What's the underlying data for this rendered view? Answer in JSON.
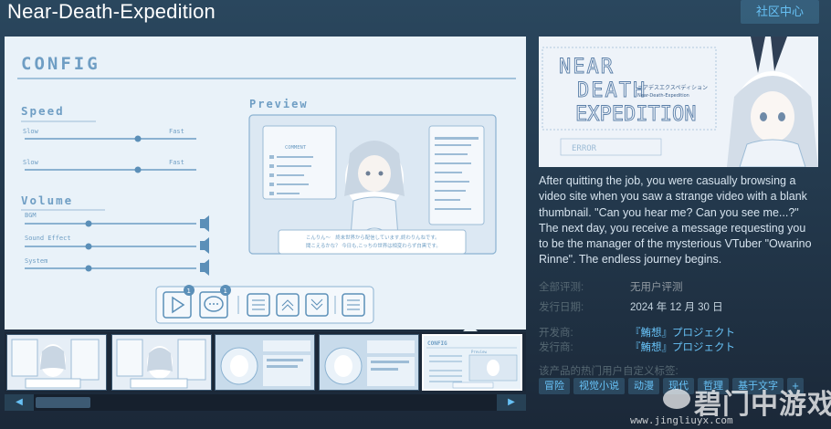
{
  "header": {
    "title": "Near-Death-Expedition",
    "community_button": "社区中心"
  },
  "screenshot": {
    "config_title": "CONFIG",
    "speed_label": "Speed",
    "slow_1": "Slow",
    "fast_1": "Fast",
    "slow_2": "Slow",
    "fast_2": "Fast",
    "volume_label": "Volume",
    "bgm_label": "BGM",
    "sound_effect_label": "Sound Effect",
    "system_label": "System",
    "preview_label": "Preview",
    "comment_label": "COMMENT",
    "dialog_line1": "こんりん〜　終末世界から配信しています,終わりんねです。",
    "dialog_line2": "聞こえるかな？ 今日も,こっちの世界は相変わらず白黒です。",
    "badge_1": "1",
    "badge_2": "1"
  },
  "capsule": {
    "title_line1": "NEAR",
    "title_line2": "DEATH",
    "title_line3": "EXPEDITION",
    "subtitle_jp": "ニアデスエクスペディション",
    "subtitle_en": "Near-Death-Expedition",
    "error_text": "ERROR"
  },
  "description": "After quitting the job, you were casually browsing a video site when you saw a strange video with a blank thumbnail. \"Can you hear me? Can you see me...?\" The next day, you receive a message requesting you to be the manager of the mysterious VTuber \"Owarino Rinne\". The endless journey begins.",
  "info": {
    "reviews_label": "全部评测:",
    "reviews_value": "无用户评测",
    "release_label": "发行日期:",
    "release_value": "2024 年 12 月 30 日",
    "developer_label": "开发商:",
    "developer_value": "『鮪想』プロジェクト",
    "publisher_label": "发行商:",
    "publisher_value": "『鮪想』プロジェクト"
  },
  "tags": {
    "label": "该产品的热门用户自定义标签:",
    "items": [
      "冒险",
      "视觉小说",
      "动漫",
      "现代",
      "哲理",
      "基于文字"
    ],
    "more": "+"
  },
  "thumbs": {
    "mini_config": "CONFIG",
    "mini_preview": "Preview"
  },
  "watermark": {
    "brand": "碧门中游戏",
    "url": "www.jingliuyx.com"
  },
  "colors": {
    "accent": "#67c1f5",
    "background": "#1b2838",
    "config_blue": "#5b8fb8"
  }
}
